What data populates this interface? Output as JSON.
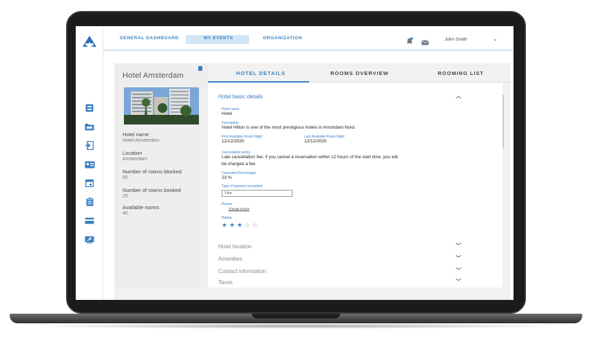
{
  "topnav": {
    "links": [
      "GENERAL DASHBOARD",
      "MY EVENTS",
      "ORGANIZATION"
    ],
    "active": "MY EVENTS",
    "user_name": "John Smith"
  },
  "sidebar_icons": [
    "dashboard-icon",
    "folder-icon",
    "login-icon",
    "id-card-icon",
    "calendar-icon",
    "clipboard-icon",
    "credit-card-icon",
    "export-icon"
  ],
  "hotel": {
    "title": "Hotel Amsterdam",
    "info": [
      {
        "label": "Hotel name",
        "value": "Hotel Amsterdam"
      },
      {
        "label": "Location",
        "value": "Amsterdam"
      },
      {
        "label": "Number of rooms blocked",
        "value": "85"
      },
      {
        "label": "Number of rooms booked",
        "value": "25"
      },
      {
        "label": "Available rooms",
        "value": "40"
      }
    ]
  },
  "tabs": [
    "HOTEL DETAILS",
    "ROOMS OVERVIEW",
    "ROOMING LIST"
  ],
  "details": {
    "section_title": "Hotel basic details",
    "hotel_name_label": "Hotel name",
    "hotel_name": "Hotel",
    "description_label": "Description",
    "description": "Hotel Hilton is one of the most prestigious hotels in Amstrdam Nord.",
    "first_night_label": "First Available Room Night",
    "first_night": "12/12/2020",
    "last_night_label": "Last Available Room Night",
    "last_night": "12/12/2020",
    "cancellation_label": "Cancellation policy",
    "cancellation_line1": "Late cancellation fee: if you cancel a reservation within 12 hours of the start time, you will",
    "cancellation_line2": "be charged a fee.",
    "commission_label": "Commited Percentage",
    "commission": "23 %",
    "payment_label": "Type of payment accepted",
    "payment_value": "Visa",
    "picture_label": "Picture",
    "picture_link": "Change picture",
    "rating_label": "Rating",
    "rating": 3,
    "rating_max": 5
  },
  "collapsed_sections": [
    "Hotel location",
    "Amenities",
    "Contact information",
    "Taxes"
  ],
  "colors": {
    "accent": "#3a7fc1",
    "panel": "#eeeeee"
  }
}
